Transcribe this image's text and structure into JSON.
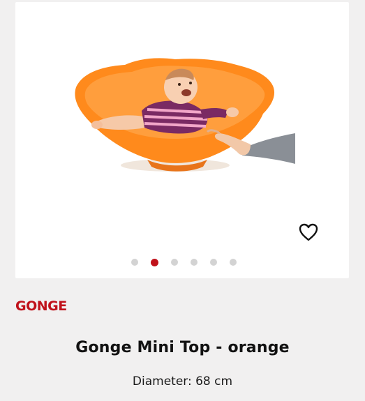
{
  "gallery": {
    "slide_count": 6,
    "active_slide": 2
  },
  "product": {
    "brand": "GONGE",
    "name": "Gonge Mini Top - orange",
    "attribute": "Diameter: 68 cm"
  },
  "icons": {
    "wishlist": "heart-outline-icon"
  },
  "colors": {
    "brand": "#c0121b",
    "background": "#f1f0f0",
    "dot_inactive": "#d3d3d3",
    "product_orange": "#ff8a1c"
  }
}
